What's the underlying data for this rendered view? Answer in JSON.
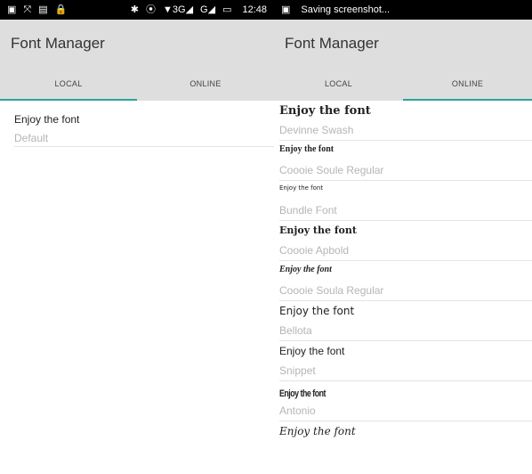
{
  "left": {
    "statusbar": {
      "icons": [
        "▣",
        "⤧",
        "▤",
        "🔒",
        "✱",
        "⦿",
        "▼3G◢",
        "G◢",
        "▭"
      ],
      "time": "12:48"
    },
    "appbar": {
      "title": "Font Manager"
    },
    "tabs": [
      {
        "label": "LOCAL",
        "active": true
      },
      {
        "label": "ONLINE",
        "active": false
      }
    ],
    "items": [
      {
        "sample": "Enjoy the font",
        "font": "Default"
      }
    ]
  },
  "right": {
    "statusbar": {
      "icon": "▣",
      "notification": "Saving screenshot..."
    },
    "appbar": {
      "title": "Font Manager"
    },
    "tabs": [
      {
        "label": "LOCAL",
        "active": false
      },
      {
        "label": "ONLINE",
        "active": true
      }
    ],
    "items": [
      {
        "sample": "Enjoy the font",
        "font": "Devinne Swash"
      },
      {
        "sample": "Enjoy the font",
        "font": "Coooie Soule Regular"
      },
      {
        "sample": "Enjoy the font",
        "font": "Bundle Font"
      },
      {
        "sample": "Enjoy the font",
        "font": "Coooie Apbold"
      },
      {
        "sample": "Enjoy the font",
        "font": "Coooie Soula Regular"
      },
      {
        "sample": "Enjoy the font",
        "font": "Bellota"
      },
      {
        "sample": "Enjoy the font",
        "font": "Snippet"
      },
      {
        "sample": "Enjoy the font",
        "font": "Antonio"
      },
      {
        "sample": "Enjoy the font",
        "font": ""
      }
    ]
  },
  "colors": {
    "accent": "#2ba39a",
    "appbar_bg": "#dedede",
    "statusbar_bg": "#000000",
    "secondary_text": "#b5b5b5"
  }
}
